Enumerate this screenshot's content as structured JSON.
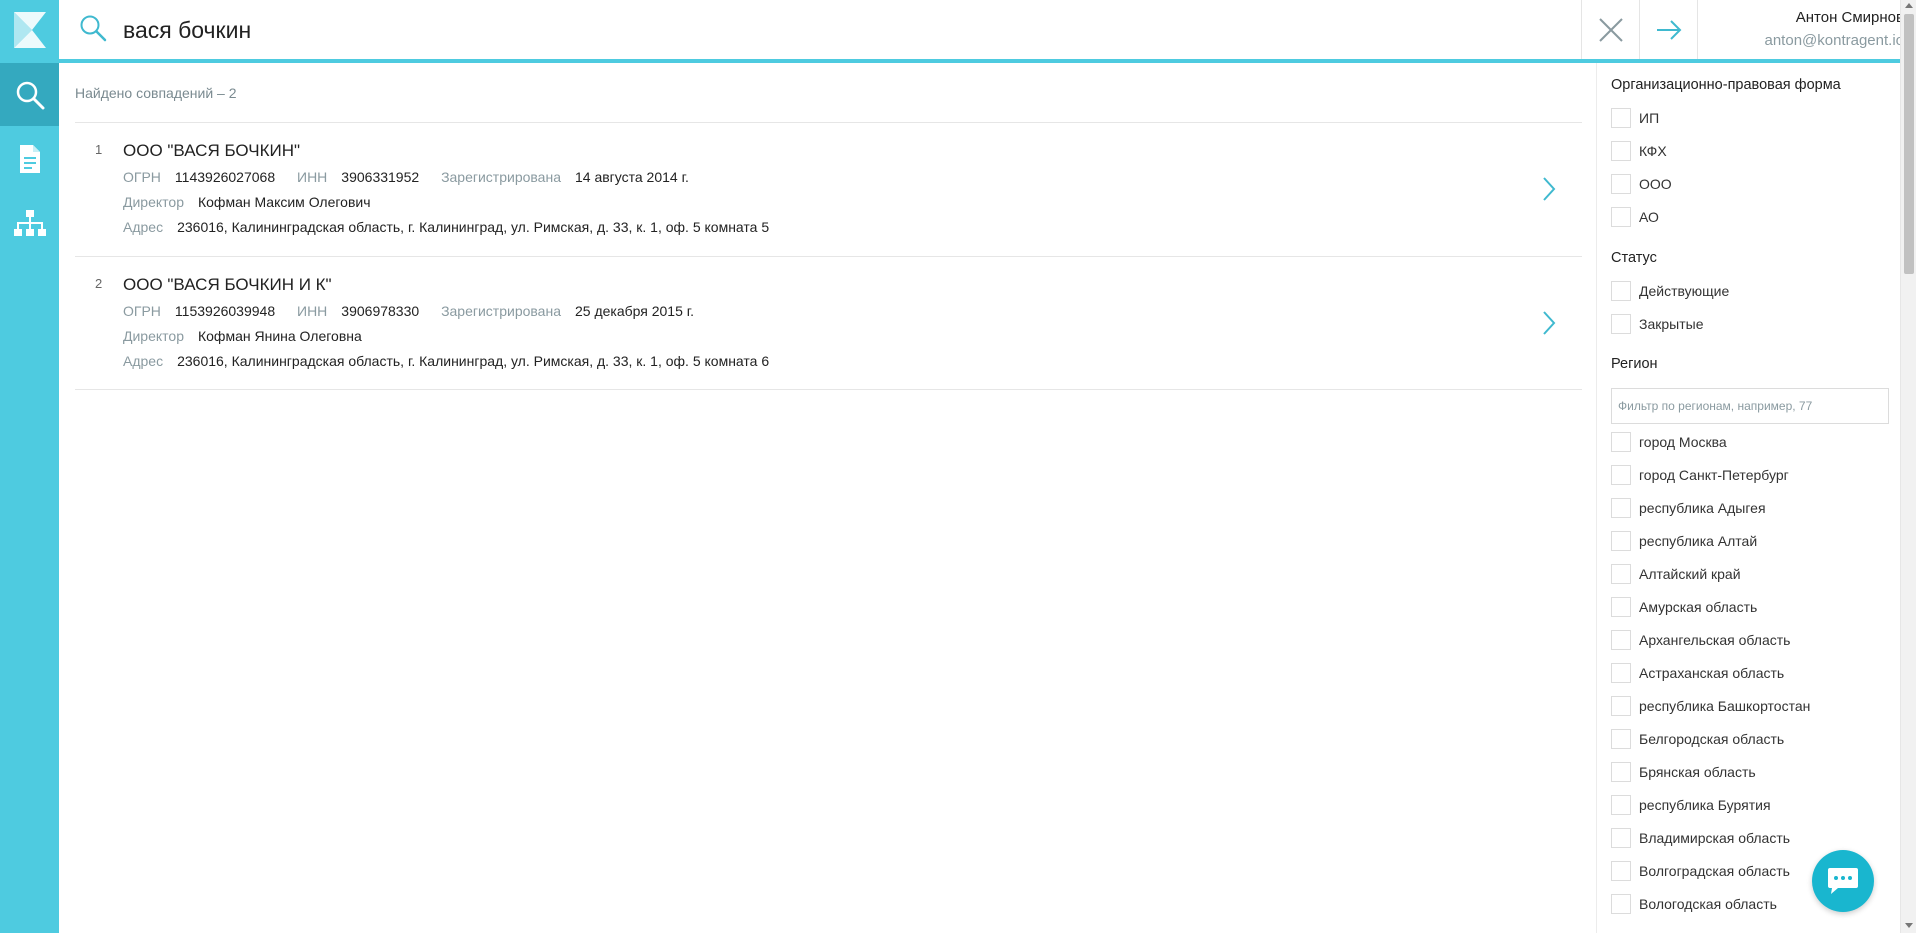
{
  "app": {
    "accent": "#4ecbe0",
    "accent_dark": "#34a9bf"
  },
  "sidebar": {
    "items": [
      {
        "name": "search",
        "icon": "search-icon",
        "active": true
      },
      {
        "name": "document",
        "icon": "document-icon",
        "active": false
      },
      {
        "name": "org-tree",
        "icon": "org-tree-icon",
        "active": false
      }
    ]
  },
  "search": {
    "query": "вася бочкин",
    "placeholder": ""
  },
  "user": {
    "name": "Антон Смирнов",
    "email": "anton@kontragent.io"
  },
  "results": {
    "found_text": "Найдено совпадений – 2",
    "labels": {
      "ogrn": "ОГРН",
      "inn": "ИНН",
      "registered": "Зарегистрирована",
      "director": "Директор",
      "address": "Адрес"
    },
    "items": [
      {
        "num": "1",
        "title": "ООО \"ВАСЯ БОЧКИН\"",
        "ogrn": "1143926027068",
        "inn": "3906331952",
        "registered": "14 августа 2014 г.",
        "director": "Кофман Максим Олегович",
        "address": "236016, Калининградская область, г. Калининград, ул. Римская, д. 33, к. 1, оф. 5 комната 5"
      },
      {
        "num": "2",
        "title": "ООО \"ВАСЯ БОЧКИН И К\"",
        "ogrn": "1153926039948",
        "inn": "3906978330",
        "registered": "25 декабря 2015 г.",
        "director": "Кофман Янина Олеговна",
        "address": "236016, Калининградская область, г. Калининград, ул. Римская, д. 33, к. 1, оф. 5 комната 6"
      }
    ]
  },
  "filters": {
    "legal_form": {
      "title": "Организационно-правовая форма",
      "options": [
        "ИП",
        "КФХ",
        "ООО",
        "АО"
      ]
    },
    "status": {
      "title": "Статус",
      "options": [
        "Действующие",
        "Закрытые"
      ]
    },
    "region": {
      "title": "Регион",
      "placeholder": "Фильтр по регионам, например, 77",
      "options": [
        "город Москва",
        "город Санкт-Петербург",
        "республика Адыгея",
        "республика Алтай",
        "Алтайский край",
        "Амурская область",
        "Архангельская область",
        "Астраханская область",
        "республика Башкортостан",
        "Белгородская область",
        "Брянская область",
        "республика Бурятия",
        "Владимирская область",
        "Волгоградская область",
        "Вологодская область"
      ]
    }
  }
}
